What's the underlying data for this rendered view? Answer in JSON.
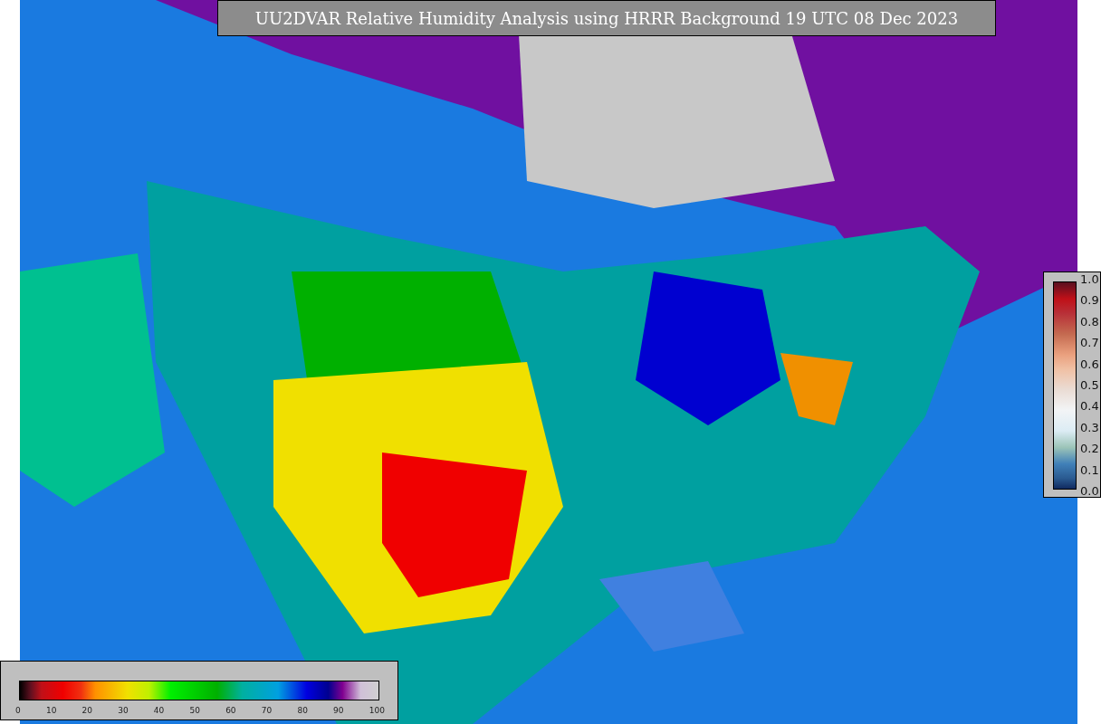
{
  "title": "UU2DVAR Relative Humidity Analysis using HRRR Background 19 UTC 08 Dec 2023",
  "ratio_legend": {
    "ticks": [
      "1.0",
      "0.9",
      "0.8",
      "0.7",
      "0.6",
      "0.5",
      "0.4",
      "0.3",
      "0.2",
      "0.1",
      "0.0"
    ]
  },
  "humidity_legend": {
    "ticks": [
      "0",
      "10",
      "20",
      "30",
      "40",
      "50",
      "60",
      "70",
      "80",
      "90",
      "100"
    ]
  }
}
